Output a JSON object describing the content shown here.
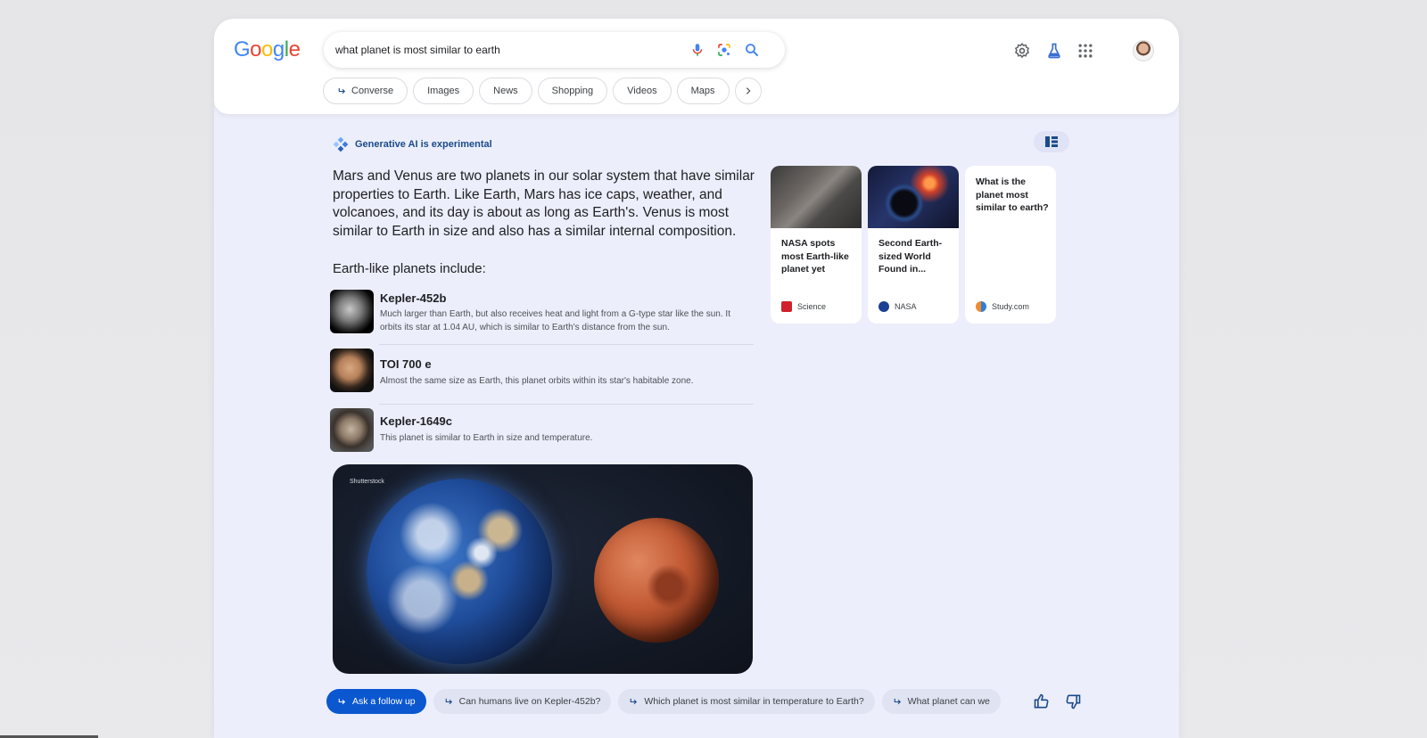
{
  "header": {
    "logo_letters": [
      "G",
      "o",
      "o",
      "g",
      "l",
      "e"
    ],
    "logo_colors": [
      "#4285F4",
      "#EA4335",
      "#FBBC05",
      "#4285F4",
      "#34A853",
      "#EA4335"
    ],
    "search_query": "what planet is most similar to earth",
    "search_icons": [
      "microphone-icon",
      "lens-icon",
      "search-icon"
    ],
    "right_icons": [
      "settings-icon",
      "labs-icon",
      "apps-grid-icon"
    ],
    "chips": [
      {
        "label": "Converse",
        "icon": "follow-up-arrow-icon"
      },
      {
        "label": "Images"
      },
      {
        "label": "News"
      },
      {
        "label": "Shopping"
      },
      {
        "label": "Videos"
      },
      {
        "label": "Maps"
      }
    ]
  },
  "ai": {
    "label": "Generative AI is experimental",
    "summary": "Mars and Venus are two planets in our solar system that have similar properties to Earth. Like Earth, Mars has ice caps, weather, and volcanoes, and its day is about as long as Earth's. Venus is most similar to Earth in size and also has a similar internal composition.",
    "list_heading": "Earth-like planets include:",
    "planets": [
      {
        "name": "Kepler-452b",
        "desc": "Much larger than Earth, but also receives heat and light from a G-type star like the sun. It orbits its star at 1.04 AU, which is similar to Earth's distance from the sun."
      },
      {
        "name": "TOI 700 e",
        "desc": "Almost the same size as Earth, this planet orbits within its star's habitable zone."
      },
      {
        "name": "Kepler-1649c",
        "desc": "This planet is similar to Earth in size and temperature."
      }
    ],
    "hero_credit": "Shutterstock"
  },
  "cards": [
    {
      "title": "NASA spots most Earth-like planet yet",
      "source": "Science",
      "fav_color": "#d0202a"
    },
    {
      "title": "Second Earth-sized World Found in...",
      "source": "NASA",
      "fav_color": "#1c3f94"
    },
    {
      "title": "What is the planet most similar to earth?",
      "source": "Study.com",
      "fav_color": "#2f7fd6"
    }
  ],
  "followups": {
    "primary": "Ask a follow up",
    "items": [
      "Can humans live on Kepler-452b?",
      "Which planet is most similar in temperature to Earth?",
      "What planet can we"
    ]
  },
  "colors": {
    "accent": "#0b57d0",
    "ai_label": "#1a4a8a",
    "panel_bg": "#eceefb"
  }
}
